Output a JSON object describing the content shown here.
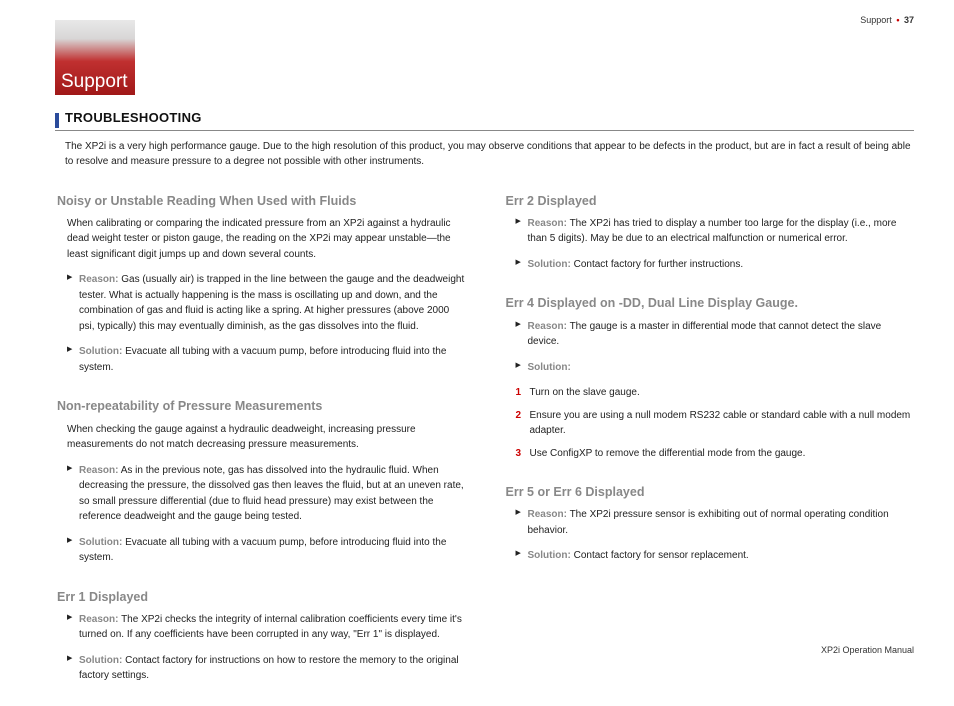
{
  "header": {
    "section": "Support",
    "page": "37"
  },
  "badge": "Support",
  "section_title": "TROUBLESHOOTING",
  "intro": "The XP2i is a very high performance gauge. Due to the high resolution of this product, you may observe conditions that appear to be defects in the product, but are in fact a result of being able to resolve and measure pressure to a degree not possible with other instruments.",
  "left": [
    {
      "title": "Noisy or Unstable Reading When Used with Fluids",
      "body": "When calibrating or comparing the indicated pressure from an XP2i against a hydraulic dead weight tester or piston gauge, the reading on the XP2i may appear unstable—the least significant digit jumps up and down several counts.",
      "reason": "Gas (usually air) is trapped in the line between the gauge and the deadweight tester. What is actually happening is the mass is oscillating up and down, and the combination of gas and fluid is acting like a spring. At higher pressures (above 2000 psi, typically) this may eventually diminish, as the gas dissolves into the fluid.",
      "solution": "Evacuate all tubing with a vacuum pump, before introducing fluid into the system."
    },
    {
      "title": "Non-repeatability of Pressure Measurements",
      "body": "When checking the gauge against a hydraulic deadweight, increasing pressure measurements do not match decreasing pressure measurements.",
      "reason": "As in the previous note, gas has dissolved into the hydraulic fluid. When decreasing the pressure, the dissolved gas then leaves the fluid, but at an uneven rate, so small pressure differential (due to fluid head pressure) may exist between the reference deadweight and the gauge being tested.",
      "solution": "Evacuate all tubing with a vacuum pump, before introducing fluid into the system."
    },
    {
      "title": "Err 1 Displayed",
      "body": "",
      "reason": "The XP2i checks the integrity of internal calibration coefficients every time it's turned on. If any coefficients have been corrupted in any way, \"Err 1\" is displayed.",
      "solution": "Contact factory for instructions on how to restore the memory to the original factory settings."
    }
  ],
  "right": [
    {
      "title": "Err 2 Displayed",
      "reason": "The XP2i has tried to display a number too large for the display (i.e., more than 5 digits). May be due to an electrical malfunction or numerical error.",
      "solution": "Contact factory for further instructions."
    },
    {
      "title": "Err 4 Displayed on -DD, Dual Line Display Gauge.",
      "reason": "The gauge is a master in differential mode that cannot detect the slave device.",
      "solution_label_only": true,
      "steps": [
        "Turn on the slave gauge.",
        "Ensure you are using a null modem RS232 cable or standard cable with a null modem adapter.",
        "Use ConfigXP to remove the differential mode from the gauge."
      ]
    },
    {
      "title": "Err 5 or Err 6 Displayed",
      "reason": "The XP2i pressure sensor is exhibiting out of normal operating condition behavior.",
      "solution": "Contact factory for sensor replacement."
    }
  ],
  "labels": {
    "reason": "Reason:",
    "solution": "Solution:"
  },
  "footer": "XP2i Operation Manual"
}
